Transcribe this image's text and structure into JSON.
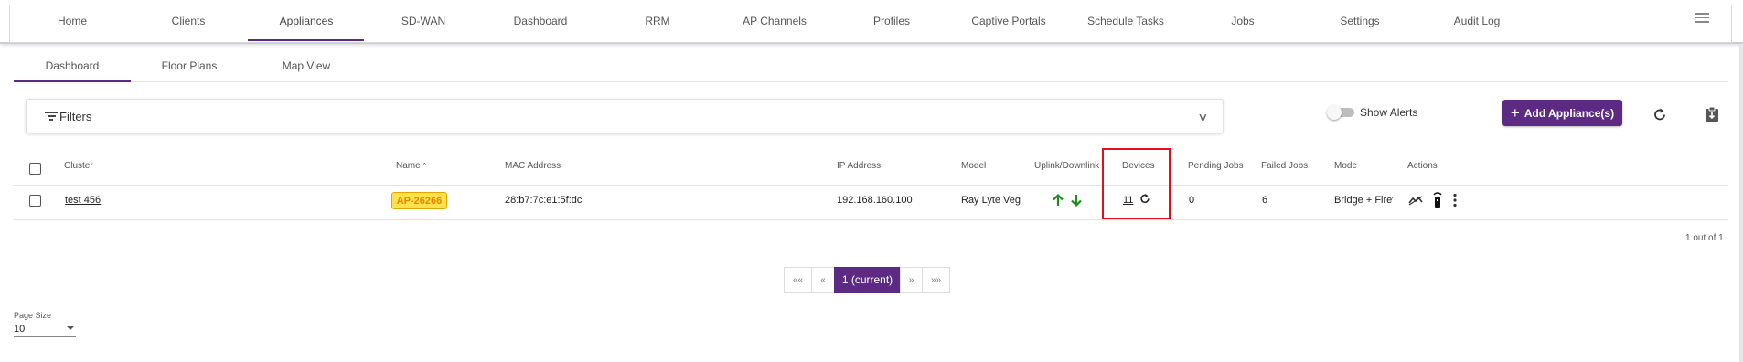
{
  "nav": {
    "items": [
      "Home",
      "Clients",
      "Appliances",
      "SD-WAN",
      "Dashboard",
      "RRM",
      "AP Channels",
      "Profiles",
      "Captive Portals",
      "Schedule Tasks",
      "Jobs",
      "Settings",
      "Audit Log"
    ],
    "active": "Appliances",
    "menu_icon": "hamburger-icon"
  },
  "subtabs": {
    "items": [
      "Dashboard",
      "Floor Plans",
      "Map View"
    ],
    "active": "Dashboard"
  },
  "filters": {
    "label": "Filters",
    "icon": "filter-icon",
    "expand_icon": "chevron-down-icon"
  },
  "alerts_toggle": {
    "label": "Show Alerts",
    "on": false
  },
  "add_button": {
    "label": "Add Appliance(s)",
    "icon": "plus-icon"
  },
  "toolbar_icons": [
    "refresh-icon",
    "export-icon"
  ],
  "table": {
    "headers": {
      "cluster": "Cluster",
      "name": "Name",
      "name_sort": "^",
      "mac": "MAC Address",
      "ip": "IP Address",
      "model": "Model",
      "uplink": "Uplink/Downlink",
      "devices": "Devices",
      "pending": "Pending Jobs",
      "failed": "Failed Jobs",
      "mode": "Mode",
      "actions": "Actions"
    },
    "rows": [
      {
        "cluster": "test 456",
        "name": "AP-26266",
        "mac": "28:b7:7c:e1:5f:dc",
        "ip": "192.168.160.100",
        "model": "Ray Lyte Veg",
        "devices": "11",
        "pending": "0",
        "failed": "6",
        "mode": "Bridge + Firev"
      }
    ]
  },
  "pagination": {
    "count_text": "1 out of 1",
    "first": "««",
    "prev": "«",
    "current": "1 (current)",
    "next": "»",
    "last": "»»"
  },
  "page_size": {
    "label": "Page Size",
    "value": "10"
  },
  "colors": {
    "accent": "#5c2a82",
    "badge_fill": "#ffe14d",
    "badge_text": "#e08a00",
    "uplink_arrows": "#1e8c1e",
    "highlight_box": "#e3101a"
  }
}
